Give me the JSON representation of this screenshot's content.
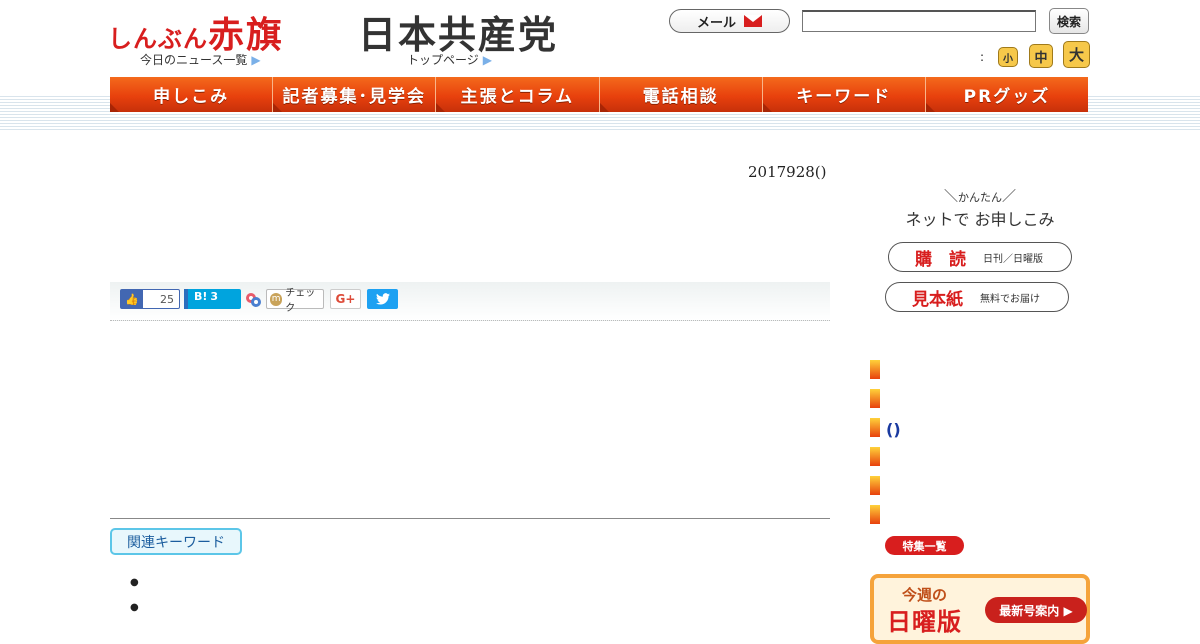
{
  "header": {
    "logo_kana": "しんぶん",
    "logo_kanji": "赤旗",
    "party_logo": "日本共産党",
    "todays_news": "今日のニュース一覧",
    "top_page": "トップページ",
    "link_arrow": "▶",
    "mail_label": "メール",
    "search_value": "",
    "search_button": "検索",
    "fontsize_label": ":",
    "fontsize_small": "小",
    "fontsize_medium": "中",
    "fontsize_large": "大"
  },
  "nav": {
    "items": [
      "申しこみ",
      "記者募集･見学会",
      "主張とコラム",
      "電話相談",
      "キーワード",
      "PRグッズ"
    ]
  },
  "article": {
    "date": "2017928()",
    "related_keywords": "関連キーワード",
    "keywords": [
      "",
      ""
    ]
  },
  "share": {
    "fb_icon": "👍",
    "fb_count": "25",
    "hatena_label": "B!",
    "hatena_count": "3",
    "mixi_icon": "m",
    "mixi_label": "チェック",
    "gplus_label": "G+",
    "tw_icon": "🐦"
  },
  "sidebar": {
    "easy_label": "かんたん",
    "net_apply": "ネットで お申しこみ",
    "subscribe_main": "購　読",
    "subscribe_sub": "日刊／日曜版",
    "sample_main": "見本紙",
    "sample_sub": "無料でお届け",
    "item_text": "()",
    "features_button": "特集一覧",
    "sunday_small": "今週の",
    "sunday_big": "日曜版",
    "latest_button": "最新号案内 ▶"
  },
  "colors": {
    "brand_red": "#d81e1e",
    "nav_orange": "#e8410d",
    "accent_gold": "#f6c84a"
  }
}
